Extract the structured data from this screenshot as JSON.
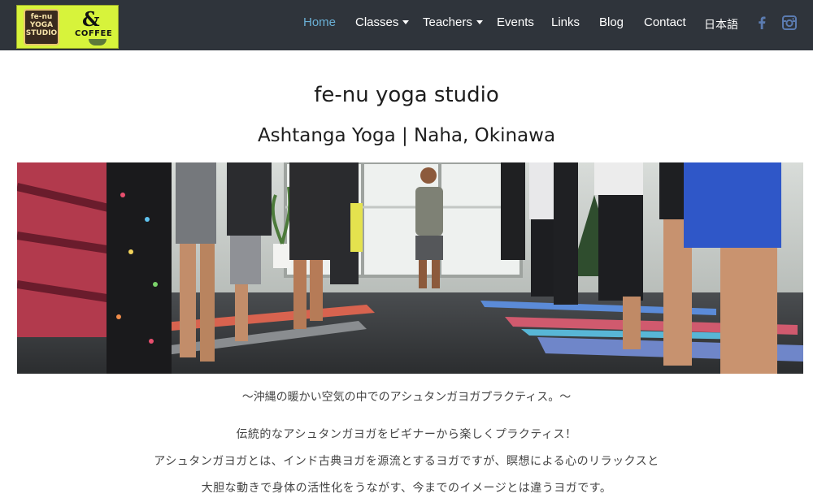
{
  "header": {
    "logo": {
      "mark_text": "fe-nu YOGA STUDIO",
      "amp": "&",
      "coffee": "COFFEE"
    },
    "nav": [
      {
        "label": "Home",
        "active": true,
        "dropdown": false
      },
      {
        "label": "Classes",
        "active": false,
        "dropdown": true
      },
      {
        "label": "Teachers",
        "active": false,
        "dropdown": true
      },
      {
        "label": "Events",
        "active": false,
        "dropdown": false
      },
      {
        "label": "Links",
        "active": false,
        "dropdown": false
      },
      {
        "label": "Blog",
        "active": false,
        "dropdown": false
      },
      {
        "label": "Contact",
        "active": false,
        "dropdown": false
      },
      {
        "label": "日本語",
        "active": false,
        "dropdown": false
      }
    ],
    "social": [
      {
        "icon": "facebook-icon"
      },
      {
        "icon": "instagram-icon"
      }
    ]
  },
  "main": {
    "title": "fe-nu yoga studio",
    "subtitle": "Ashtanga Yoga | Naha, Okinawa",
    "tagline": "〜沖縄の暖かい空気の中でのアシュタンガヨガプラクティス。〜",
    "paragraphs": [
      "伝統的なアシュタンガヨガをビギナーから楽しくプラクティス！",
      "アシュタンガヨガとは、インド古典ヨガを源流とするヨガですが、瞑想による心のリラックスと",
      "大胆な動きで身体の活性化をうながす、今までのイメージとは違うヨガです。"
    ]
  },
  "colors": {
    "navbar_bg": "#2f343b",
    "nav_text": "#ffffff",
    "nav_active": "#6ab0d6",
    "logo_bg": "#d7f33b",
    "social_icon": "#5b7bb0"
  }
}
